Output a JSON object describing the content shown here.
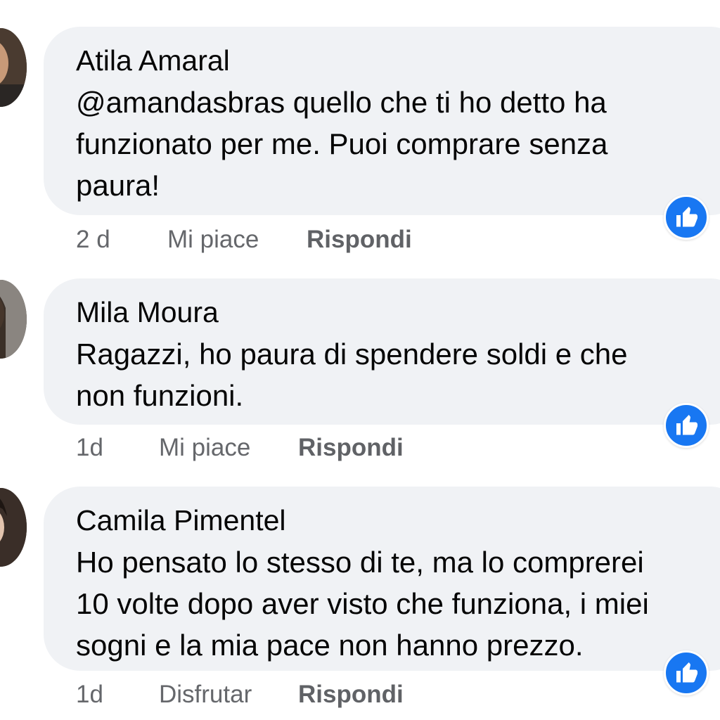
{
  "comments": [
    {
      "author": "Atila Amaral",
      "text": "@amandasbras quello che ti ho detto ha\nfunzionato per me. Puoi comprare senza\npaura!",
      "time": "2 d",
      "like_label": "Mi piace",
      "reply_label": "Rispondi",
      "reaction_icon": "thumbs-up-icon"
    },
    {
      "author": "Mila Moura",
      "text": "Ragazzi, ho paura di spendere soldi e che\nnon funzioni.",
      "time": "1d",
      "like_label": "Mi piace",
      "reply_label": "Rispondi",
      "reaction_icon": "thumbs-up-icon"
    },
    {
      "author": "Camila Pimentel",
      "text": "Ho pensato lo stesso di te, ma lo comprerei\n10 volte dopo aver visto che funziona, i miei\nsogni e la mia pace non hanno prezzo.",
      "time": "1d",
      "like_label": "Disfrutar",
      "reply_label": "Rispondi",
      "reaction_icon": "thumbs-up-icon"
    }
  ],
  "colors": {
    "bubble": "#f0f2f5",
    "reaction": "#1877f2",
    "meta_text": "#65676b"
  }
}
